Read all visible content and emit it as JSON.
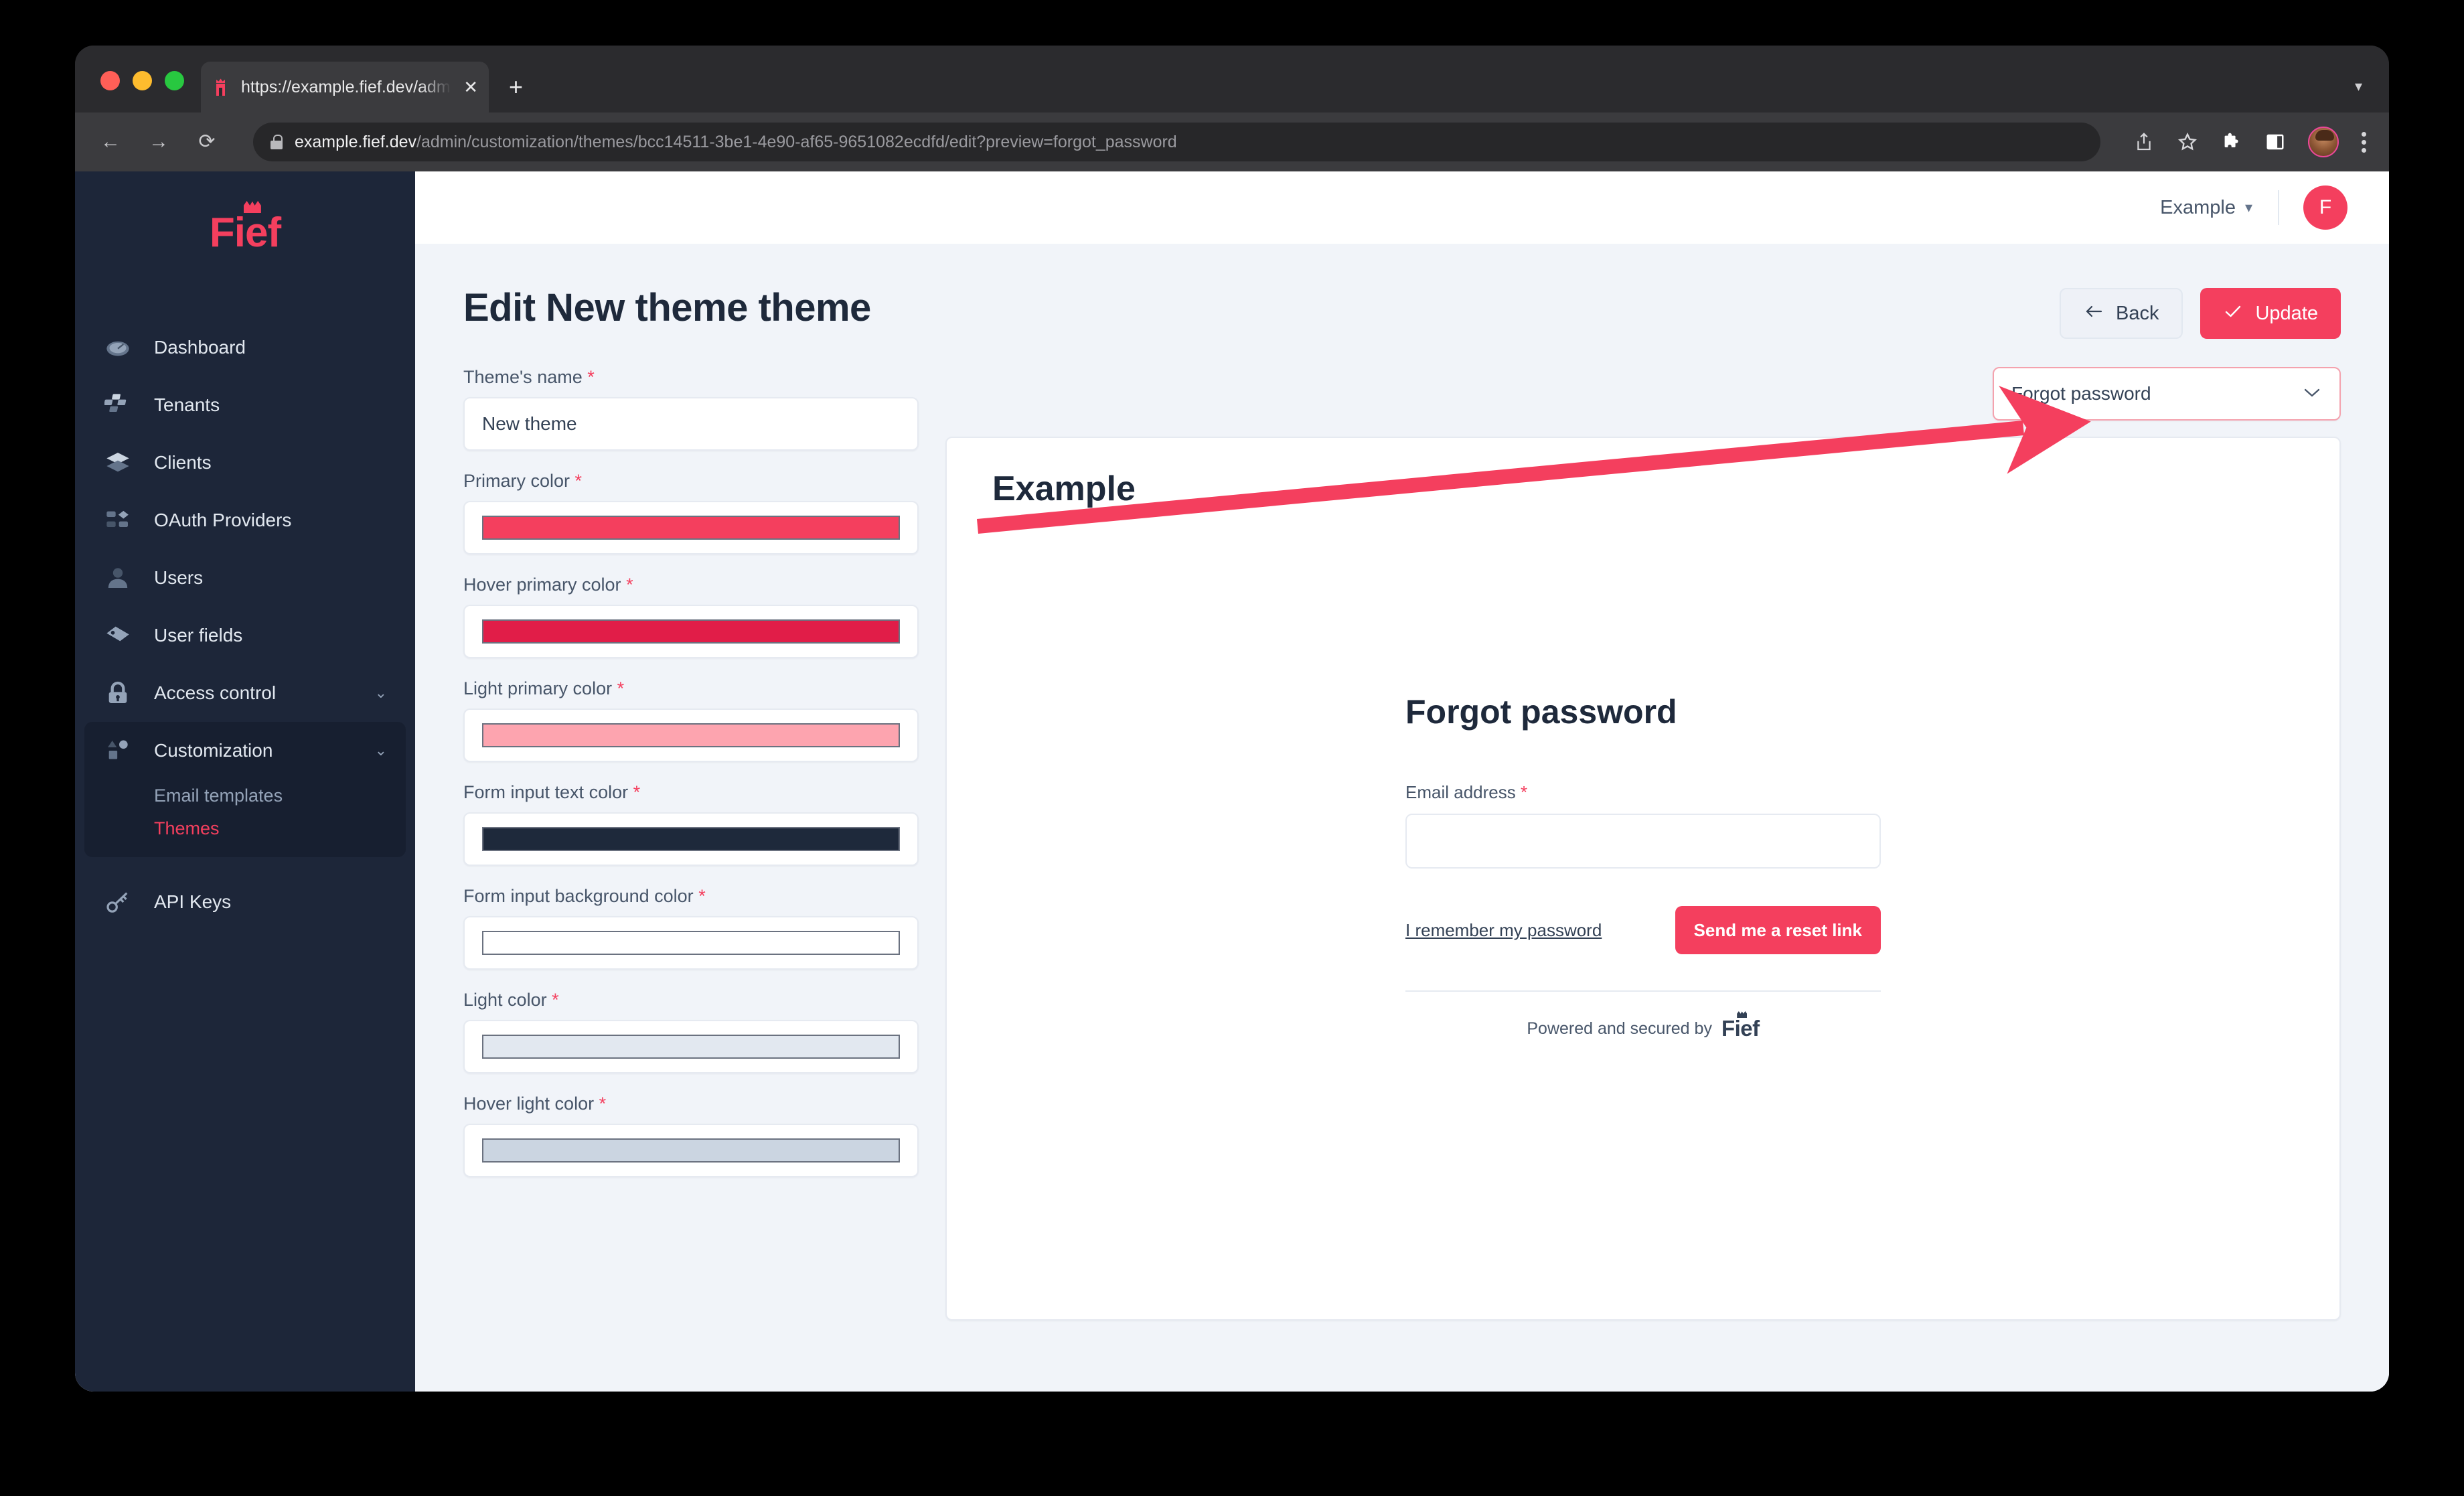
{
  "browser": {
    "tab": {
      "title": "https://example.fief.dev/admin/",
      "favicon_icon": "fief-crown-icon",
      "close_icon": "close-icon"
    },
    "new_tab_icon": "plus-icon",
    "tab_list_icon": "chevron-down-icon",
    "back_icon": "arrow-left-icon",
    "forward_icon": "arrow-right-icon",
    "reload_icon": "reload-icon",
    "lock_icon": "lock-icon",
    "url_host": "example.fief.dev",
    "url_path": "/admin/customization/themes/bcc14511-3be1-4e90-af65-9651082ecdfd/edit?preview=forgot_password",
    "toolbar_icons": [
      "share-icon",
      "star-icon",
      "extensions-puzzle-icon",
      "side-panel-icon",
      "profile-avatar-icon",
      "kebab-menu-icon"
    ]
  },
  "sidebar": {
    "brand": "Fief",
    "items": [
      {
        "label": "Dashboard",
        "icon": "speedometer-icon"
      },
      {
        "label": "Tenants",
        "icon": "blocks-icon"
      },
      {
        "label": "Clients",
        "icon": "layers-icon"
      },
      {
        "label": "OAuth Providers",
        "icon": "shapes-grid-icon"
      },
      {
        "label": "Users",
        "icon": "person-icon"
      },
      {
        "label": "User fields",
        "icon": "tag-icon"
      },
      {
        "label": "Access control",
        "icon": "lock-icon",
        "chevron": "⌄"
      },
      {
        "label": "Customization",
        "icon": "shapes-icon",
        "chevron": "⌄"
      },
      {
        "label": "API Keys",
        "icon": "key-icon"
      }
    ],
    "customization_children": [
      {
        "label": "Email templates",
        "active": false
      },
      {
        "label": "Themes",
        "active": true
      }
    ]
  },
  "topbar": {
    "tenant": "Example",
    "tenant_chevron_icon": "chevron-down-icon",
    "avatar_initial": "F"
  },
  "page": {
    "title": "Edit New theme theme",
    "back_label": "Back",
    "back_icon": "arrow-left-icon",
    "update_label": "Update",
    "update_icon": "check-icon"
  },
  "form": {
    "fields": [
      {
        "label": "Theme's name",
        "required": true,
        "type": "text",
        "value": "New theme"
      },
      {
        "label": "Primary color",
        "required": true,
        "type": "color",
        "value": "#f43f5e"
      },
      {
        "label": "Hover primary color",
        "required": true,
        "type": "color",
        "value": "#e11d48"
      },
      {
        "label": "Light primary color",
        "required": true,
        "type": "color",
        "value": "#fda4af"
      },
      {
        "label": "Form input text color",
        "required": true,
        "type": "color",
        "value": "#1e293b"
      },
      {
        "label": "Form input background color",
        "required": true,
        "type": "color",
        "value": "#ffffff"
      },
      {
        "label": "Light color",
        "required": true,
        "type": "color",
        "value": "#e2e8f0"
      },
      {
        "label": "Hover light color",
        "required": true,
        "type": "color",
        "value": "#cbd5e1"
      }
    ]
  },
  "preview": {
    "selected_page": "Forgot password",
    "select_chevron_icon": "chevron-down-icon",
    "brand": "Example",
    "title": "Forgot password",
    "email_label": "Email address",
    "email_required": true,
    "email_value": "",
    "remember_link": "I remember my password",
    "submit_label": "Send me a reset link",
    "footer_text": "Powered and secured by",
    "footer_brand": "Fief"
  },
  "annotation": {
    "type": "arrow",
    "color": "#f43f5e",
    "points_to": "preview-page-select"
  }
}
